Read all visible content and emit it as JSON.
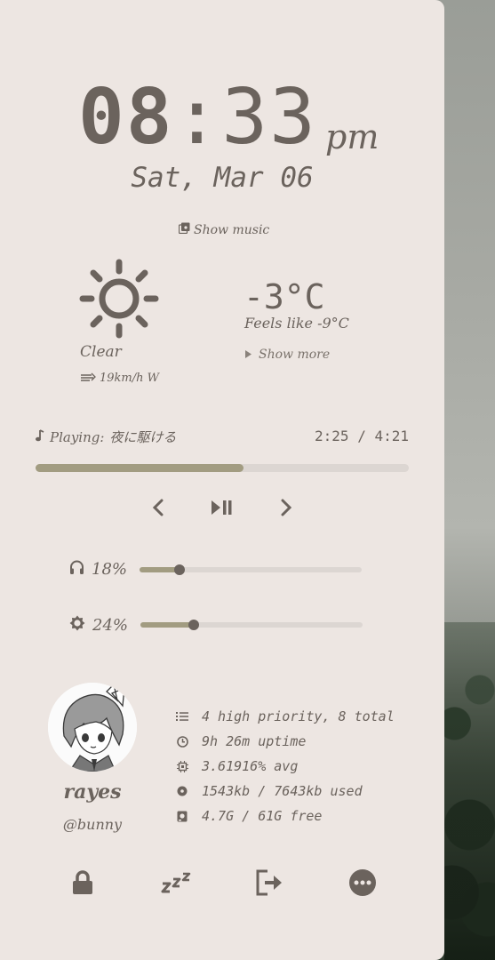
{
  "clock": {
    "hours": "08",
    "separator": ":",
    "minutes": "33",
    "ampm": "pm"
  },
  "date": "Sat, Mar 06",
  "show_music_label": "Show music",
  "weather": {
    "icon": "sun-icon",
    "condition": "Clear",
    "wind": "19km/h W",
    "temperature": "-3°C",
    "feels_like": "Feels like -9°C",
    "show_more_label": "Show more"
  },
  "player": {
    "playing_label": "Playing:",
    "track": "夜に駆ける",
    "time": "2:25 / 4:21",
    "progress_fraction": 0.556
  },
  "volume": {
    "icon": "headphones-icon",
    "label": "18%",
    "value": 0.18
  },
  "brightness": {
    "icon": "brightness-icon",
    "label": "24%",
    "value": 0.24
  },
  "user": {
    "name": "rayes",
    "handle": "@bunny"
  },
  "stats": [
    {
      "icon": "list-icon",
      "text": "4 high priority, 8 total"
    },
    {
      "icon": "clock-icon",
      "text": "9h 26m uptime"
    },
    {
      "icon": "cpu-icon",
      "text": "3.61916% avg"
    },
    {
      "icon": "memory-icon",
      "text": "1543kb / 7643kb used"
    },
    {
      "icon": "disk-icon",
      "text": "4.7G / 61G free"
    }
  ],
  "colors": {
    "panel": "#ede6e2",
    "text": "#6b635d",
    "accent": "#a29c81",
    "track": "#dcd6d2"
  }
}
